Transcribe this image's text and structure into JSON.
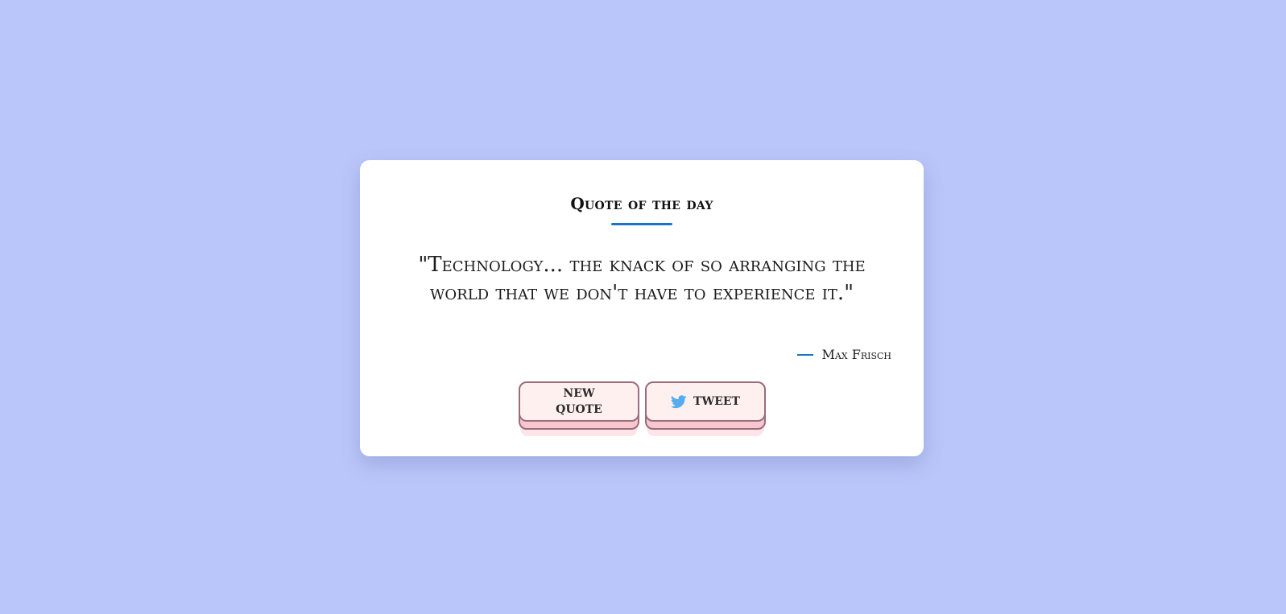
{
  "card": {
    "title": "Quote of the day",
    "quote": "\"Technology... the knack of so arranging the world that we don't have to experience it.\"",
    "author": "Max Frisch"
  },
  "buttons": {
    "new_quote_label": "New Quote",
    "tweet_label": "Tweet"
  },
  "icons": {
    "author_dash": "dash-line",
    "tweet": "twitter-icon"
  },
  "colors": {
    "background": "#bac6f9",
    "card": "#ffffff",
    "accent": "#1a73c8",
    "button_face": "#fff0f0",
    "button_shadow": "#f7c6cf",
    "button_border": "#9a6c7c",
    "twitter": "#55acee"
  }
}
